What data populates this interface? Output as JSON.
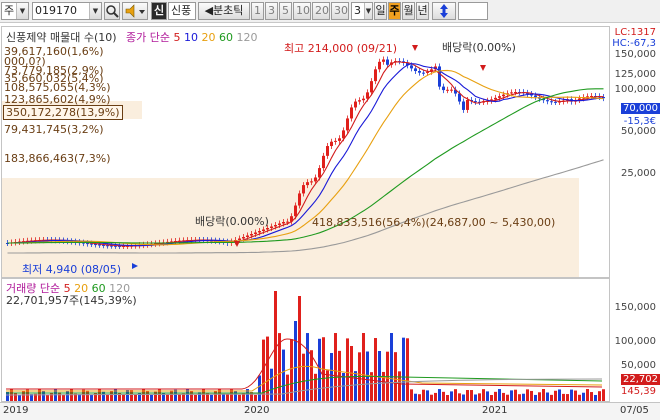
{
  "toolbar": {
    "market": "주",
    "code": "019170",
    "shin_label": "신",
    "stock_name": "신풍",
    "split_label": "분초틱",
    "periods": [
      "1",
      "3",
      "5",
      "10",
      "20",
      "30"
    ],
    "period_count": "3",
    "tabs": [
      "일",
      "주",
      "월",
      "년"
    ]
  },
  "price_panel": {
    "legend_title": "신풍제약 매물대 수(10)",
    "legend_ma_title": "종가 단순",
    "ma_periods": [
      "5",
      "10",
      "20",
      "60",
      "120"
    ],
    "ma_colors": [
      "#d21c1c",
      "#1a1ad8",
      "#e8a010",
      "#1f9a1f",
      "#9a9a9a"
    ],
    "high_label": "최고 214,000 (09/21)",
    "low_label": "최저 4,940 (08/05)",
    "dividend_labels": [
      "배당락(0.00%)",
      "배당락(0.00%)"
    ],
    "right_top": [
      "LC:1317",
      "HC:-67,3"
    ],
    "volume_profile_labels": [
      "39,617,160(1,6%)",
      "000,0?)",
      "73,779,185(2,9%)",
      "35,660,032(5,4%)",
      "108,575,055(4,3%)",
      "123,865,602(4,9%)",
      "350,172,278(13,9%)",
      "79,431,745(3,2%)",
      "183,866,463(7,3%)",
      "418,833,516(56,4%)(24,687,00 ~ 5,430,00)"
    ],
    "y_ticks": [
      "150,000",
      "125,000",
      "100,000",
      "75,000",
      "50,000",
      "25,000"
    ],
    "current_price": "70,000",
    "current_change": "-15,3€"
  },
  "volume_panel": {
    "legend_title": "거래량 단순",
    "ma_periods": [
      "5",
      "20",
      "60",
      "120"
    ],
    "ma_colors": [
      "#d21c1c",
      "#e8a010",
      "#1f9a1f",
      "#9a9a9a"
    ],
    "volume_readout": "22,701,957주(145,39%)",
    "y_ticks": [
      "150,000",
      "100,000",
      "50,000"
    ],
    "current_volume": "22,702",
    "current_pct": "145,39"
  },
  "x_ticks": [
    "2019",
    "2020",
    "2021",
    "07/05"
  ],
  "colors": {
    "up": "#e0201c",
    "down": "#1a3fd8",
    "highlight": "#faeede",
    "profile_text": "#6a3e14"
  }
}
